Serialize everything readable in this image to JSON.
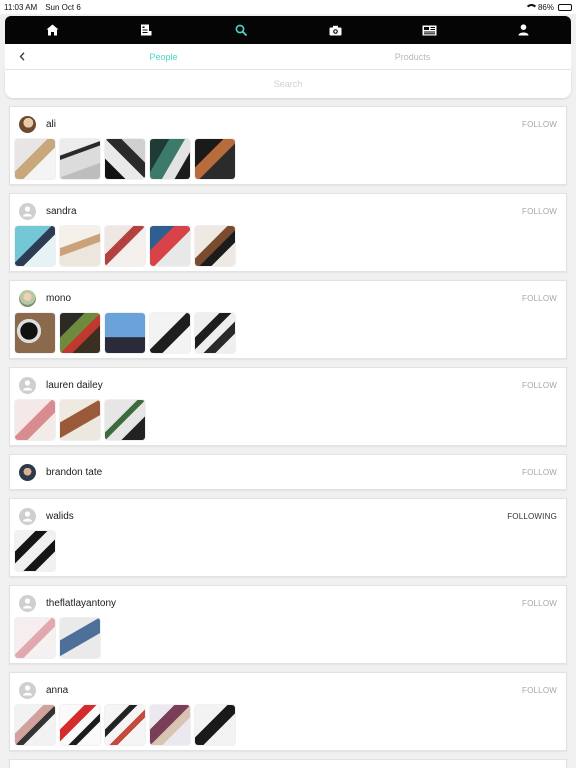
{
  "status_bar": {
    "time": "11:03 AM",
    "date": "Sun Oct 6",
    "battery": "86%"
  },
  "nav": {
    "icons": [
      "home-icon",
      "feed-icon",
      "search-icon",
      "camera-icon",
      "news-icon",
      "user-icon"
    ]
  },
  "tabs": {
    "people": "People",
    "products": "Products"
  },
  "search": {
    "placeholder": "Search",
    "value": ""
  },
  "users": [
    {
      "name": "ali",
      "action": "FOLLOW"
    },
    {
      "name": "sandra",
      "action": "FOLLOW"
    },
    {
      "name": "mono",
      "action": "FOLLOW"
    },
    {
      "name": "lauren dailey",
      "action": "FOLLOW"
    },
    {
      "name": "brandon tate",
      "action": "FOLLOW"
    },
    {
      "name": "walids",
      "action": "FOLLOWING"
    },
    {
      "name": "theflatlayantony",
      "action": "FOLLOW"
    },
    {
      "name": "anna",
      "action": "FOLLOW"
    }
  ],
  "colors": {
    "accent": "#4fd6c3",
    "nav_bg": "#050505",
    "card_bg": "#ffffff",
    "page_bg": "#f0f0f0"
  }
}
